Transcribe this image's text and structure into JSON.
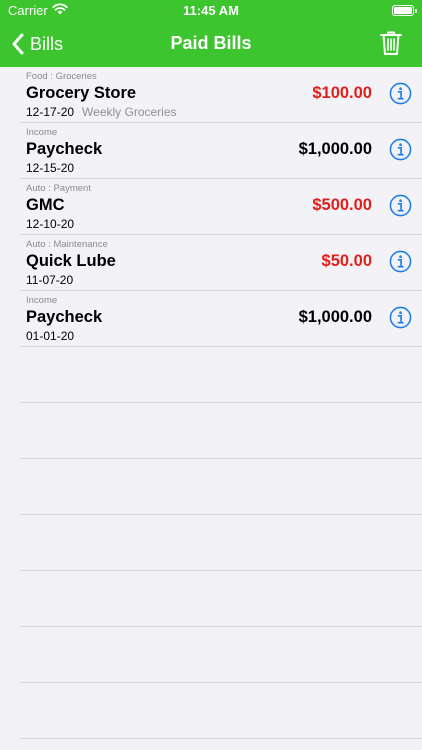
{
  "status_bar": {
    "carrier": "Carrier",
    "time": "11:45 AM"
  },
  "nav": {
    "back_label": "Bills",
    "title": "Paid Bills"
  },
  "colors": {
    "header_green": "#3cc52f",
    "expense_red": "#e0201c",
    "info_blue": "#1a7be8"
  },
  "bills": [
    {
      "category": "Food : Groceries",
      "name": "Grocery Store",
      "date": "12-17-20",
      "note": "Weekly Groceries",
      "amount": "$100.00",
      "type": "expense"
    },
    {
      "category": "Income",
      "name": "Paycheck",
      "date": "12-15-20",
      "note": "",
      "amount": "$1,000.00",
      "type": "income"
    },
    {
      "category": "Auto : Payment",
      "name": "GMC",
      "date": "12-10-20",
      "note": "",
      "amount": "$500.00",
      "type": "expense"
    },
    {
      "category": "Auto : Maintenance",
      "name": "Quick Lube",
      "date": "11-07-20",
      "note": "",
      "amount": "$50.00",
      "type": "expense"
    },
    {
      "category": "Income",
      "name": "Paycheck",
      "date": "01-01-20",
      "note": "",
      "amount": "$1,000.00",
      "type": "income"
    }
  ]
}
